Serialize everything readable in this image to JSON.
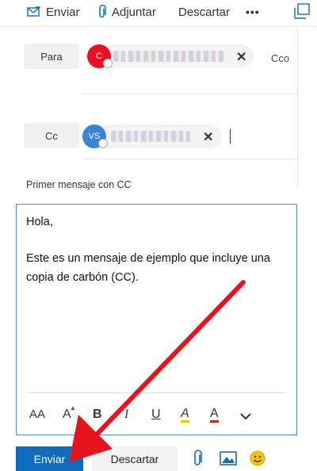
{
  "toolbar": {
    "send_label": "Enviar",
    "attach_label": "Adjuntar",
    "discard_label": "Descartar",
    "more_label": "•••"
  },
  "to_field": {
    "button_label": "Para",
    "recipient_initial": "C",
    "avatar_color": "#e81123",
    "bcc_label": "Cco"
  },
  "cc_field": {
    "button_label": "Cc",
    "recipient_initials": "VS",
    "avatar_color": "#3b83d6"
  },
  "subject": "Primer mensaje con CC",
  "body": {
    "greeting": "Hola,",
    "line1": "Este es un mensaje de ejemplo que incluye una",
    "line2": "copia de carbón (CC)."
  },
  "format_toolbar": {
    "font_size_icon": "AA",
    "font_grow_icon": "A",
    "italic_icon": "I",
    "underline_icon": "U",
    "highlight_icon": "A",
    "font_color_icon": "A",
    "expand_icon": "chevron-down"
  },
  "actions": {
    "send_label": "Enviar",
    "discard_label": "Descartar"
  },
  "colors": {
    "accent": "#0f6cbd",
    "arrow": "#e8141c",
    "highlight": "#f4c400",
    "font_color": "#d92020"
  }
}
